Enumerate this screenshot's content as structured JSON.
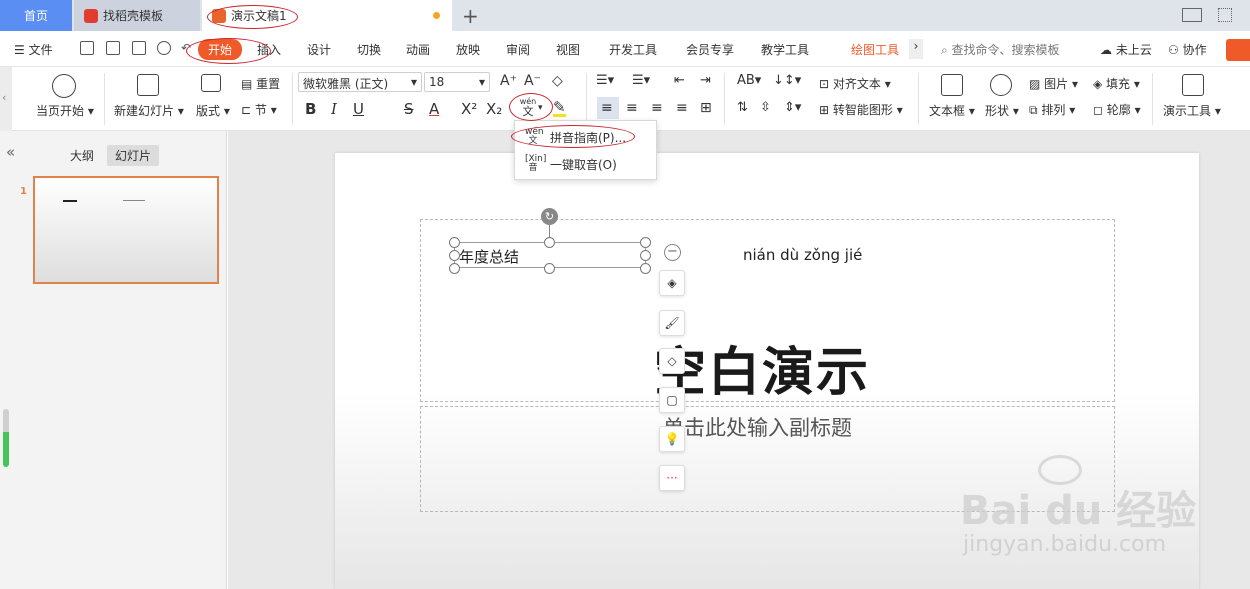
{
  "tabs": {
    "home": "首页",
    "template": "找稻壳模板",
    "document": "演示文稿1"
  },
  "menu": {
    "file": "文件",
    "items": [
      "开始",
      "插入",
      "设计",
      "切换",
      "动画",
      "放映",
      "审阅",
      "视图",
      "开发工具",
      "会员专享",
      "教学工具",
      "绘图工具"
    ],
    "search_placeholder": "查找命令、搜索模板",
    "cloud": "未上云",
    "collab": "协作"
  },
  "ribbon": {
    "play_from_current": "当页开始",
    "new_slide": "新建幻灯片",
    "layout": "版式",
    "reset": "重置",
    "section": "节",
    "font_name": "微软雅黑 (正文)",
    "font_size": "18",
    "align_text": "对齐文本",
    "smart_graphic": "转智能图形",
    "text_box": "文本框",
    "shape": "形状",
    "picture": "图片",
    "arrange": "排列",
    "fill": "填充",
    "outline": "轮廓",
    "presentation_tools": "演示工具",
    "pinyin_glyph_top": "wén",
    "pinyin_glyph_char": "文"
  },
  "dropdown": {
    "items": [
      {
        "glyph_top": "wén",
        "glyph_char": "文",
        "label": "拼音指南(P)..."
      },
      {
        "glyph_top": "[Xin]",
        "glyph_char": "音",
        "label": "一键取音(O)"
      }
    ]
  },
  "leftpanel": {
    "outline_tab": "大纲",
    "slides_tab": "幻灯片",
    "slide_number": "1"
  },
  "slide": {
    "textbox_text": "年度总结",
    "pinyin_text": "nián dù zǒng jié",
    "title": "空白演示",
    "subtitle_placeholder": "单击此处输入副标题"
  },
  "watermark": {
    "brand": "Bai du 经验",
    "url": "jingyan.baidu.com"
  },
  "colors": {
    "accent": "#f05a28",
    "home_tab": "#5b8ef2",
    "selection": "#e0834a",
    "annotation": "#c9262d"
  }
}
